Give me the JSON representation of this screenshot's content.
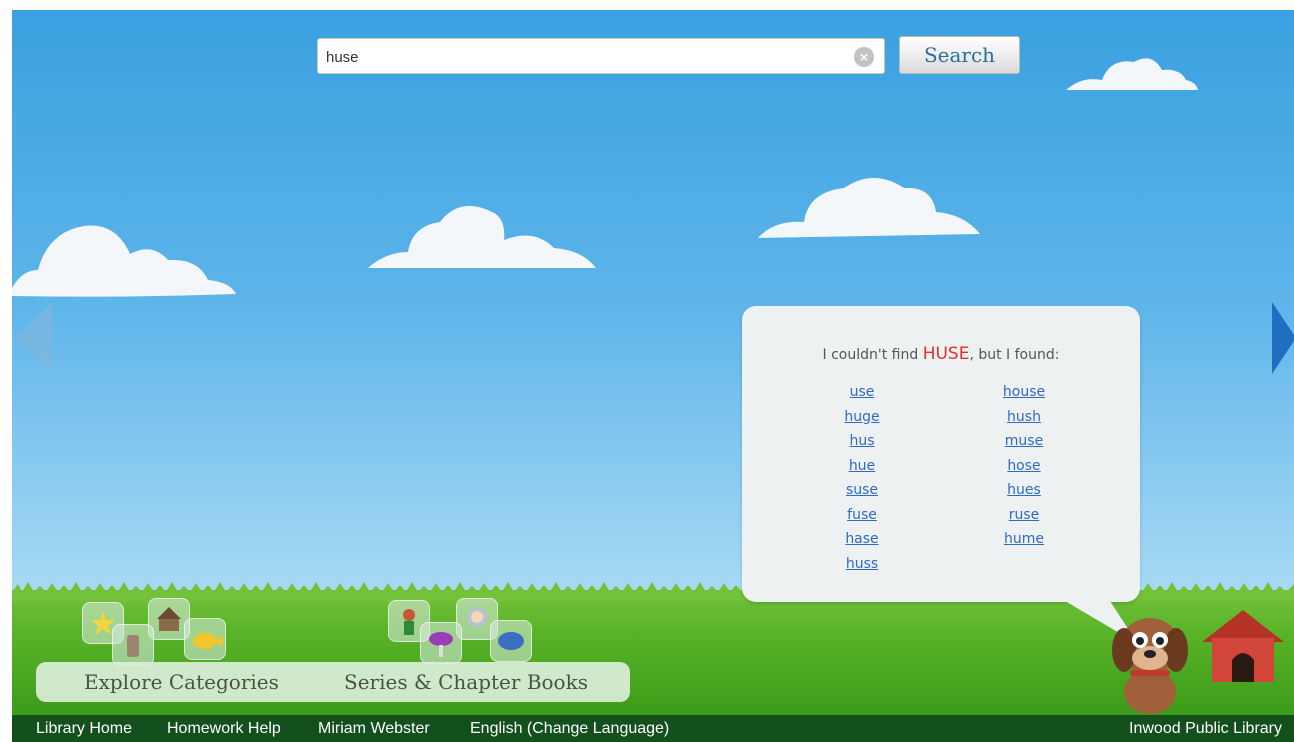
{
  "search": {
    "value": "huse",
    "button_label": "Search"
  },
  "results": {
    "message_prefix": "I couldn't find ",
    "missing_word": "HUSE",
    "message_suffix": ", but I found:",
    "suggestions_left": [
      "use",
      "huge",
      "hus",
      "hue",
      "suse",
      "fuse",
      "hase",
      "huss"
    ],
    "suggestions_right": [
      "house",
      "hush",
      "muse",
      "hose",
      "hues",
      "ruse",
      "hume"
    ]
  },
  "categories": {
    "explore": "Explore Categories",
    "series": "Series & Chapter Books"
  },
  "footer": {
    "links": [
      "Library Home",
      "Homework Help",
      "Miriam Webster",
      "English (Change Language)"
    ],
    "library_name": "Inwood Public Library"
  },
  "colors": {
    "sky_top": "#3aa0df",
    "grass": "#58b327",
    "footer": "#14501e",
    "highlight": "#e2302f",
    "link": "#2f6ac5"
  },
  "icons": [
    "clear-icon",
    "left-arrow-icon",
    "right-arrow-icon",
    "puppy-mascot",
    "doghouse-icon"
  ]
}
